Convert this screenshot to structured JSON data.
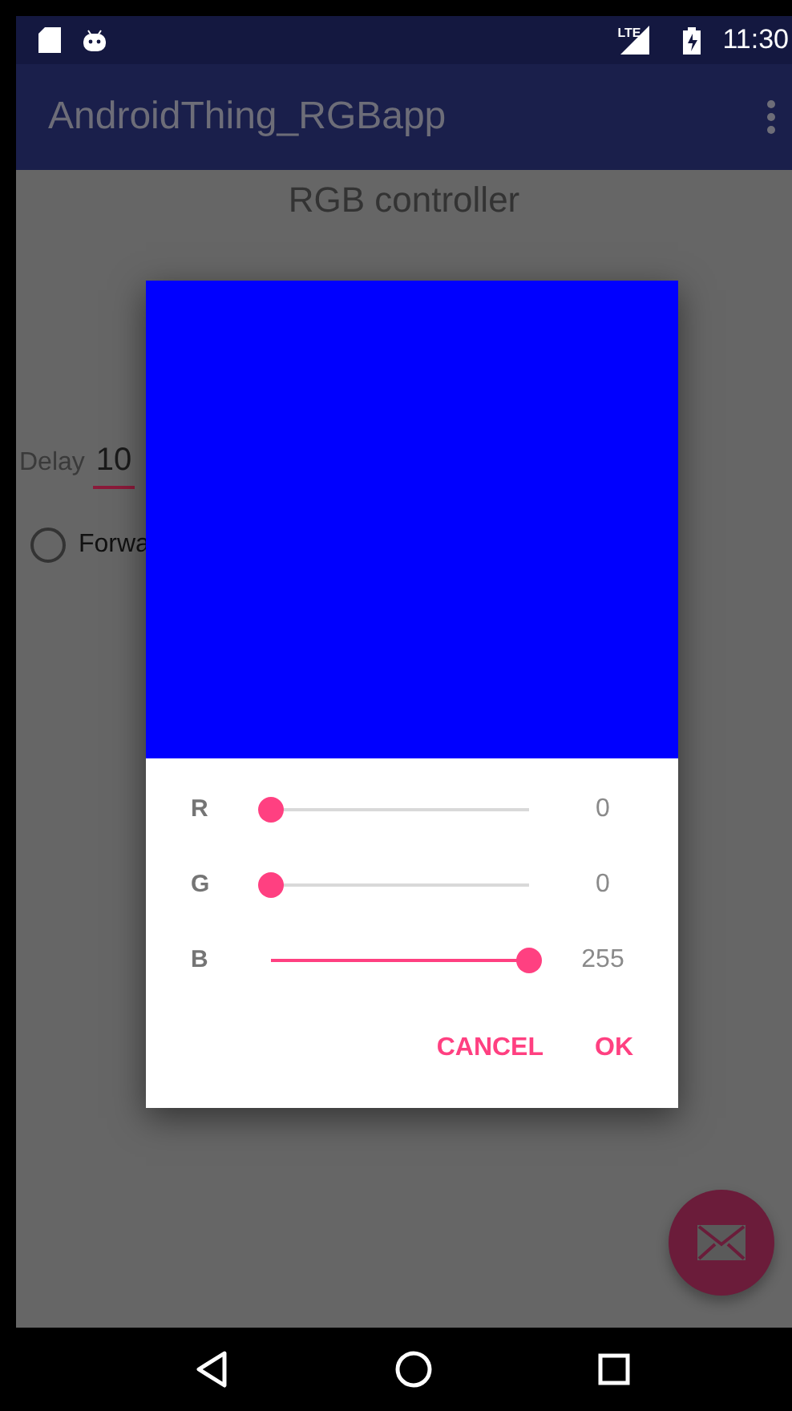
{
  "status_bar": {
    "network": "LTE",
    "time": "11:30"
  },
  "app_bar": {
    "title": "AndroidThing_RGBapp"
  },
  "content": {
    "heading": "RGB controller",
    "delay_label": "Delay",
    "delay_value": "10",
    "radio": {
      "label": "Forwa",
      "selected": false
    }
  },
  "dialog": {
    "channels": [
      {
        "label": "R",
        "level": 0,
        "reading": "0"
      },
      {
        "label": "G",
        "level": 0,
        "reading": "0"
      },
      {
        "label": "B",
        "level": 1,
        "reading": "255"
      }
    ],
    "buttons": [
      "CANCEL",
      "OK"
    ]
  }
}
